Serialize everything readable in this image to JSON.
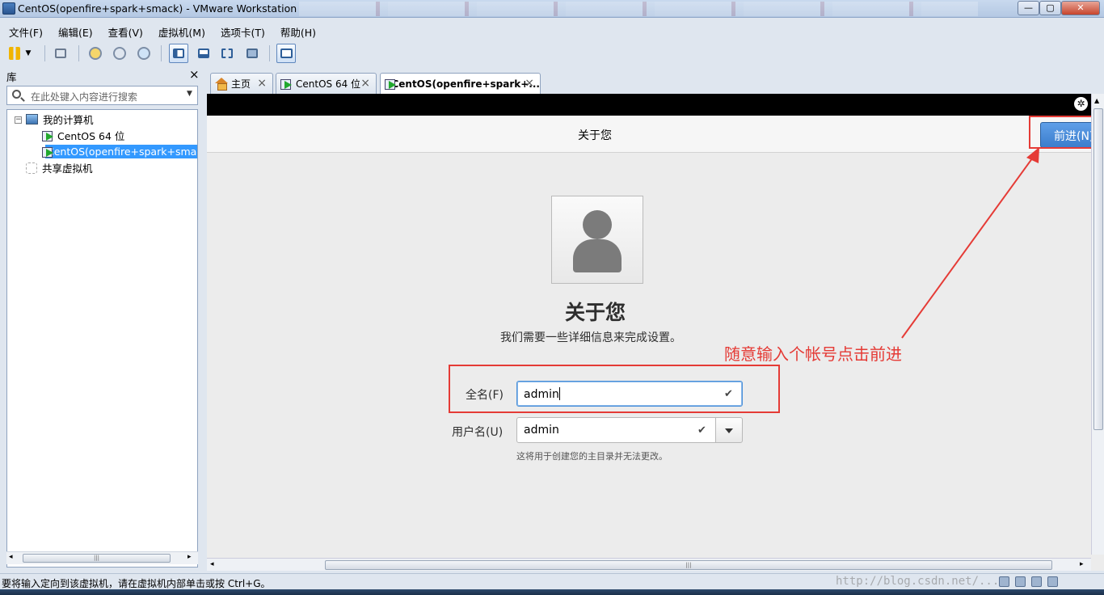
{
  "window": {
    "title": "CentOS(openfire+spark+smack) - VMware Workstation"
  },
  "menu": [
    "文件(F)",
    "编辑(E)",
    "查看(V)",
    "虚拟机(M)",
    "选项卡(T)",
    "帮助(H)"
  ],
  "toolbar_icons": [
    "pause-icon",
    "network-icon",
    "snapshot-icon",
    "revert-snapshot-icon",
    "snapshot-manager-icon",
    "library-view-icon",
    "thumbnail-view-icon",
    "fullscreen-icon",
    "unity-icon",
    "console-view-icon"
  ],
  "library": {
    "title": "库",
    "close": "×",
    "search_placeholder": "在此处键入内容进行搜索",
    "tree": {
      "root": "我的计算机",
      "items": [
        "CentOS 64 位",
        "CentOS(openfire+spark+smack)"
      ],
      "shared": "共享虚拟机"
    }
  },
  "tabs": [
    {
      "label": "主页",
      "icon": "home-icon"
    },
    {
      "label": "CentOS 64 位",
      "icon": "vm-icon"
    },
    {
      "label": "CentOS(openfire+spark+...",
      "icon": "vm-icon",
      "active": true
    }
  ],
  "tab_close": "×",
  "guest": {
    "header_title": "关于您",
    "next_button": "前进(N)",
    "heading": "关于您",
    "subheading": "我们需要一些详细信息来完成设置。",
    "annotation": "随意输入个帐号点击前进",
    "full_name": {
      "label": "全名(F)",
      "value": "admin"
    },
    "username": {
      "label": "用户名(U)",
      "value": "admin"
    },
    "hint": "这将用于创建您的主目录并无法更改。",
    "check": "✔",
    "a11y": "✲"
  },
  "status": {
    "message": "要将输入定向到该虚拟机，请在虚拟机内部单击或按 Ctrl+G。",
    "watermark": "http://blog.csdn.net/..."
  },
  "colors": {
    "annotation_red": "#e53b36",
    "next_button_blue": "#3b7dcc",
    "selection_blue": "#3399ff"
  }
}
